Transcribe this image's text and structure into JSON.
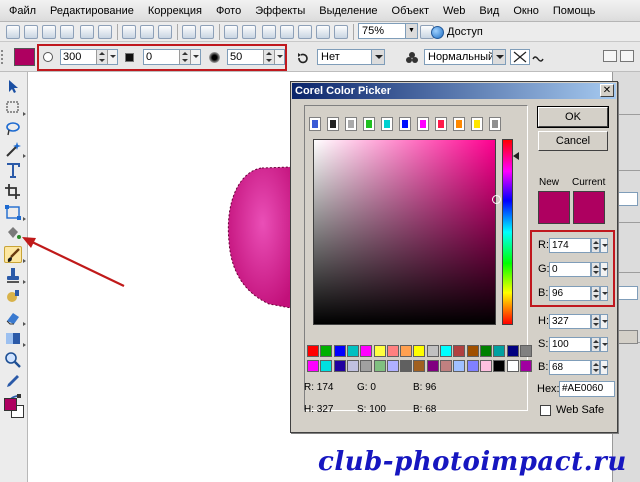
{
  "menu": {
    "items": [
      "Файл",
      "Редактирование",
      "Коррекция",
      "Фото",
      "Эффекты",
      "Выделение",
      "Объект",
      "Web",
      "Вид",
      "Окно",
      "Помощь"
    ]
  },
  "toolbar": {
    "zoom": "75%",
    "access_label": "Доступ"
  },
  "attributes": {
    "size": "300",
    "transparency": "0",
    "soft_edge": "50",
    "texture_mode": "Нет",
    "blend_mode": "Нормальный",
    "color": "#ae0060"
  },
  "dialog": {
    "title": "Corel Color Picker",
    "ok_label": "OK",
    "cancel_label": "Cancel",
    "new_label": "New",
    "current_label": "Current",
    "new_color": "#ae0060",
    "current_color": "#ae0060",
    "rgb": {
      "r_label": "R:",
      "r": "174",
      "g_label": "G:",
      "g": "0",
      "b_label": "B:",
      "b": "96"
    },
    "hsb": {
      "h_label": "H:",
      "h": "327",
      "s_label": "S:",
      "s": "100",
      "b_label": "B:",
      "b": "68"
    },
    "hex_label": "Hex:",
    "hex": "#AE0060",
    "websafe_label": "Web Safe",
    "readout": {
      "r": "R: 174",
      "g": "G: 0",
      "b": "B: 96",
      "h": "H: 327",
      "s": "S: 100",
      "v": "B: 68"
    },
    "color_models": [
      "#3b5bd6",
      "#222222",
      "#aaaaaa",
      "#20c020",
      "#00d0d0",
      "#0010ff",
      "#ff00ff",
      "#ff1a4a",
      "#ff8800",
      "#ffe600",
      "#909090"
    ],
    "palette_row1": [
      "#ff0000",
      "#00b000",
      "#0000ff",
      "#00c0c0",
      "#ff00ff",
      "#ffff40",
      "#ff8080",
      "#ffa050",
      "#ffff00",
      "#c0c0c0",
      "#00ffff",
      "#b04040",
      "#a05000",
      "#008000",
      "#00a0a0",
      "#000080",
      "#808080"
    ],
    "palette_row2": [
      "#ff00ff",
      "#00e0e0",
      "#2000a0",
      "#c0c0e0",
      "#a0a0a0",
      "#80c080",
      "#b0b0ff",
      "#606060",
      "#a06020",
      "#800080",
      "#c08080",
      "#a0c0ff",
      "#8080ff",
      "#ffc0e0",
      "#000000",
      "#ffffff",
      "#a000a0"
    ]
  },
  "watermark": "club-photoimpact.ru"
}
